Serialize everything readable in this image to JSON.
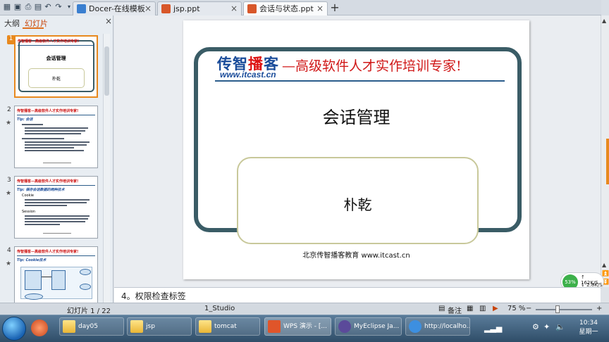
{
  "tabs": [
    {
      "label": "Docer-在线模板"
    },
    {
      "label": "jsp.ppt"
    },
    {
      "label": "会话与状态.ppt"
    }
  ],
  "panel": {
    "tab_outline": "大纲",
    "tab_slides": "幻灯片"
  },
  "slide_numbers": [
    "1",
    "2",
    "3",
    "4"
  ],
  "thumbnails": {
    "header": "传智播客—高级软件人才实作培训专家!",
    "slide1_title": "会话管理",
    "slide1_author": "朴乾",
    "slide2_tip": "Tip: 会话",
    "slide3_tip": "Tip: 保存会话数据的两种技术",
    "slide3_item1": "Cookie",
    "slide3_item2": "Session",
    "slide4_tip": "Tip: Cookie技术"
  },
  "slide": {
    "logo_part1": "传智",
    "logo_part2": "播",
    "logo_part3": "客",
    "logo_url": "www.itcast.cn",
    "slogan": "—高级软件人才实作培训专家!",
    "title": "会话管理",
    "author": "朴乾",
    "footer": "北京传智播客教育  www.itcast.cn"
  },
  "notes": "4。权限检查标签",
  "network": {
    "percent": "53%",
    "upload": "162K/S",
    "download": "2.8K/S"
  },
  "status": {
    "slide_counter": "幻灯片 1 / 22",
    "theme": "1_Studio",
    "notes_label": "备注",
    "zoom": "75 %"
  },
  "taskbar": {
    "items": [
      {
        "label": "day05"
      },
      {
        "label": "jsp"
      },
      {
        "label": "tomcat"
      },
      {
        "label": "WPS 演示 - [..."
      },
      {
        "label": "MyEclipse Ja..."
      },
      {
        "label": "http://localho..."
      }
    ],
    "time": "10:34",
    "day": "星期一"
  },
  "colors": {
    "accent": "#e8891e",
    "brand_blue": "#1a4c9a",
    "slogan_red": "#d01818",
    "frame": "#3a5c66"
  }
}
